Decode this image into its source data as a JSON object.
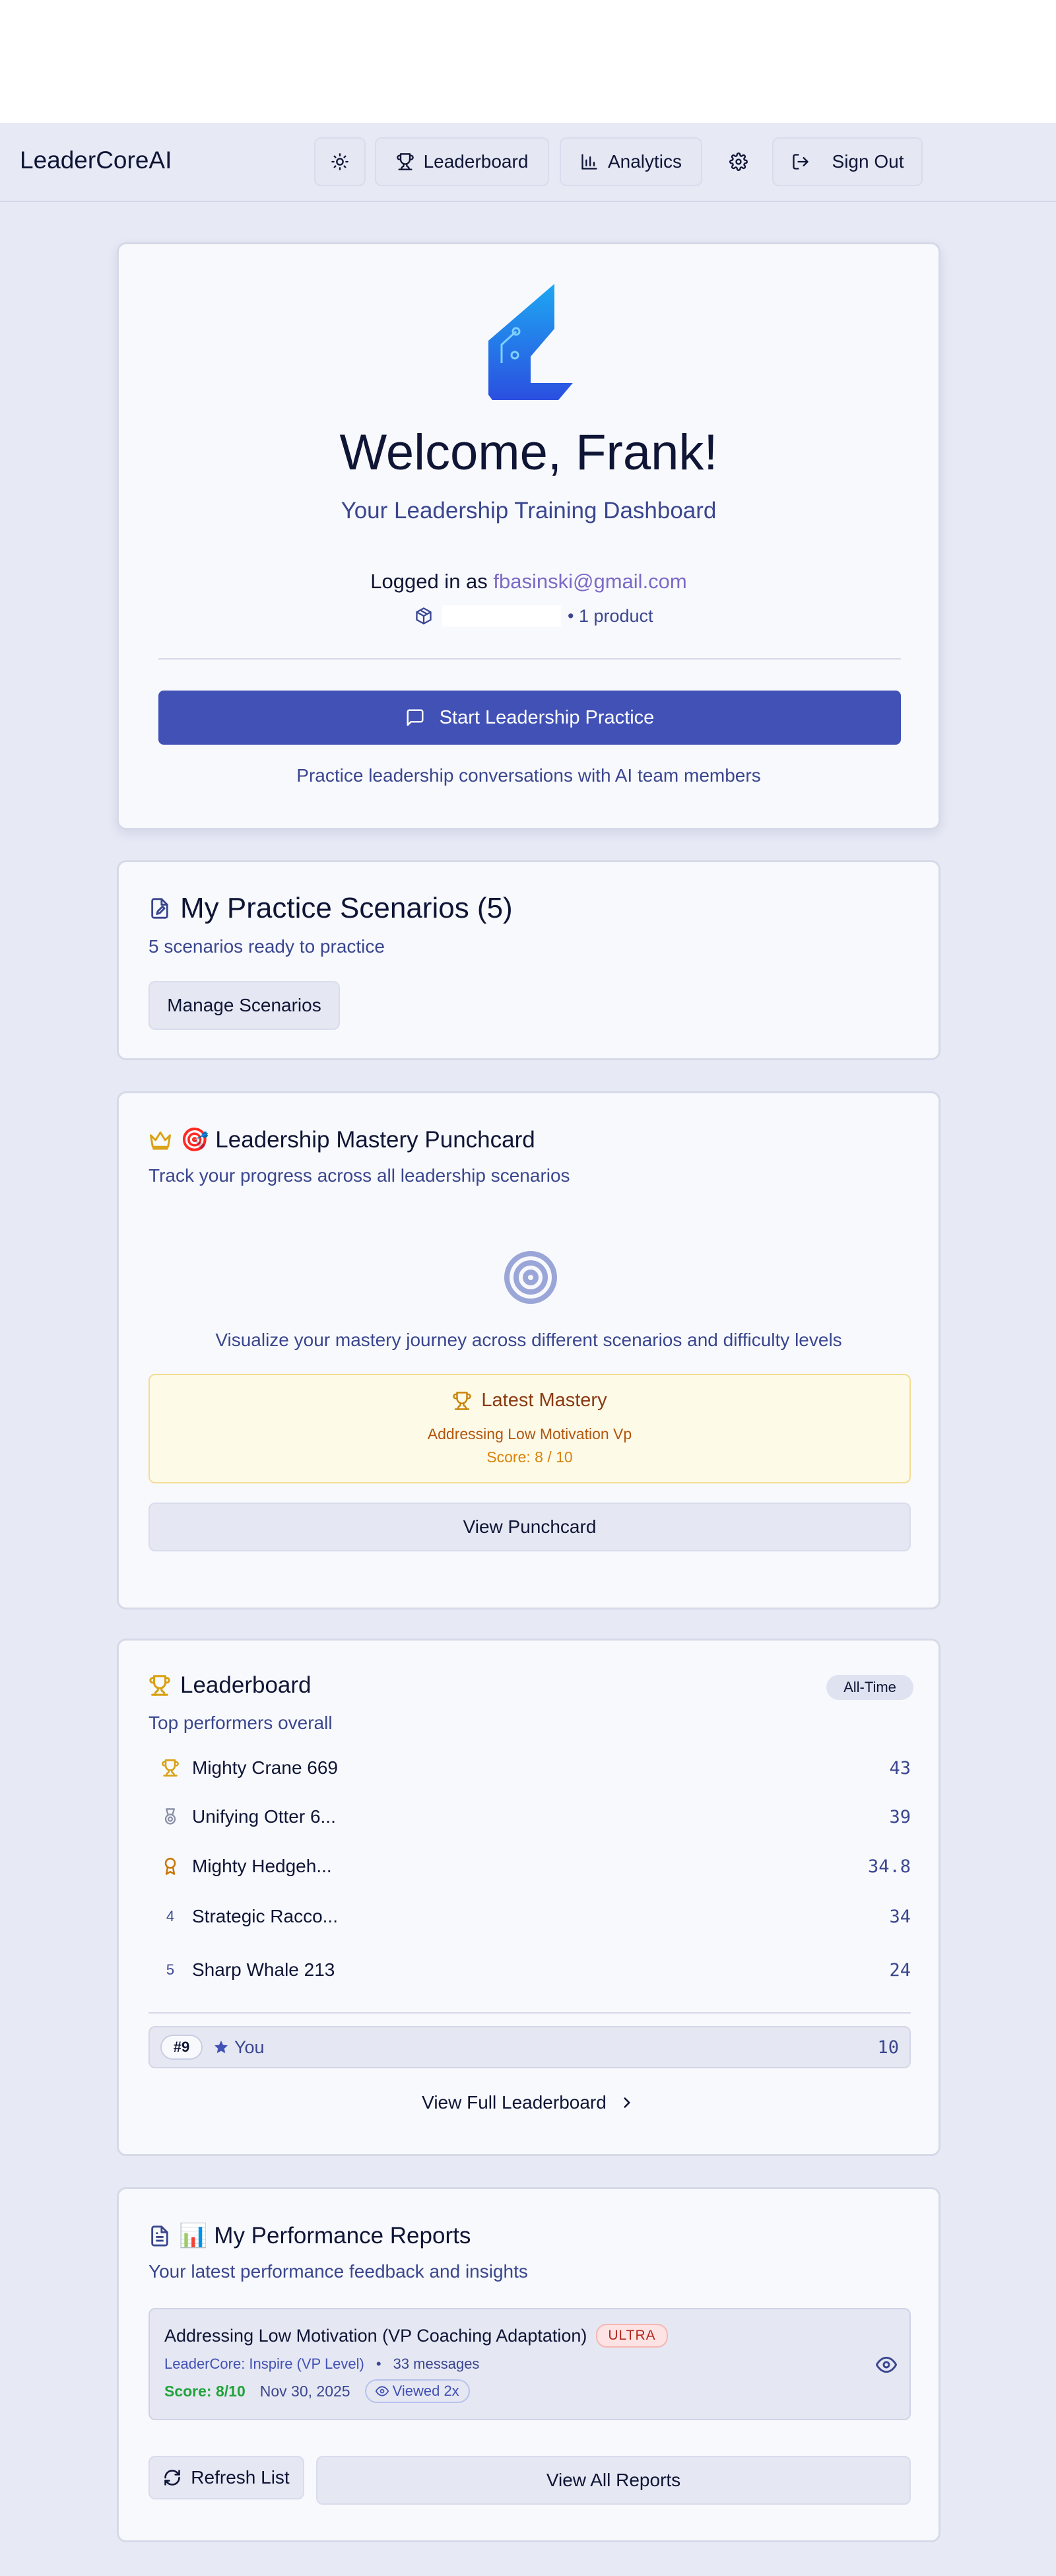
{
  "app": {
    "brand": "LeaderCoreAI"
  },
  "nav": {
    "theme_icon": "sun-icon",
    "leaderboard_label": "Leaderboard",
    "analytics_label": "Analytics",
    "settings_icon": "gear-icon",
    "signout_label": "Sign Out"
  },
  "welcome": {
    "title": "Welcome, Frank!",
    "subtitle": "Your Leadership Training Dashboard",
    "logged_in_prefix": "Logged in as ",
    "email": "fbasinski@gmail.com",
    "product_count": "• 1 product",
    "start_button": "Start Leadership Practice",
    "hint": "Practice leadership conversations with AI team members"
  },
  "scenarios": {
    "title": "My Practice Scenarios (5)",
    "subtitle": "5 scenarios ready to practice",
    "manage_button": "Manage Scenarios"
  },
  "punchcard": {
    "title": "🎯 Leadership Mastery Punchcard",
    "subtitle": "Track your progress across all leadership scenarios",
    "visualize_text": "Visualize your mastery journey across different scenarios and difficulty levels",
    "latest_label": "Latest Mastery",
    "latest_scenario": "Addressing Low Motivation Vp",
    "latest_score": "Score: 8 / 10",
    "view_button": "View Punchcard"
  },
  "leaderboard": {
    "title": "Leaderboard",
    "badge": "All-Time",
    "subtitle": "Top performers overall",
    "rows": [
      {
        "rank": "1",
        "name": "Mighty Crane 669",
        "score": "43"
      },
      {
        "rank": "2",
        "name": "Unifying Otter 6...",
        "score": "39"
      },
      {
        "rank": "3",
        "name": "Mighty Hedgeh...",
        "score": "34.8"
      },
      {
        "rank": "4",
        "name": "Strategic Racco...",
        "score": "34"
      },
      {
        "rank": "5",
        "name": "Sharp Whale 213",
        "score": "24"
      }
    ],
    "you": {
      "rank": "#9",
      "name": "You",
      "score": "10"
    },
    "view_full": "View Full Leaderboard"
  },
  "reports": {
    "title": "📊 My Performance Reports",
    "subtitle": "Your latest performance feedback and insights",
    "item": {
      "title": "Addressing Low Motivation (VP Coaching Adaptation)",
      "tier": "ULTRA",
      "product": "LeaderCore: Inspire (VP Level)",
      "messages": "33 messages",
      "score": "Score: 8/10",
      "date": "Nov 30, 2025",
      "viewed": "Viewed 2x"
    },
    "refresh_button": "Refresh List",
    "view_all_button": "View All Reports"
  },
  "colors": {
    "primary": "#4151b5",
    "accent_purple": "#7c6ac7",
    "gold": "#d9a112",
    "success": "#21a33a",
    "danger_bg": "#fde3e3"
  }
}
